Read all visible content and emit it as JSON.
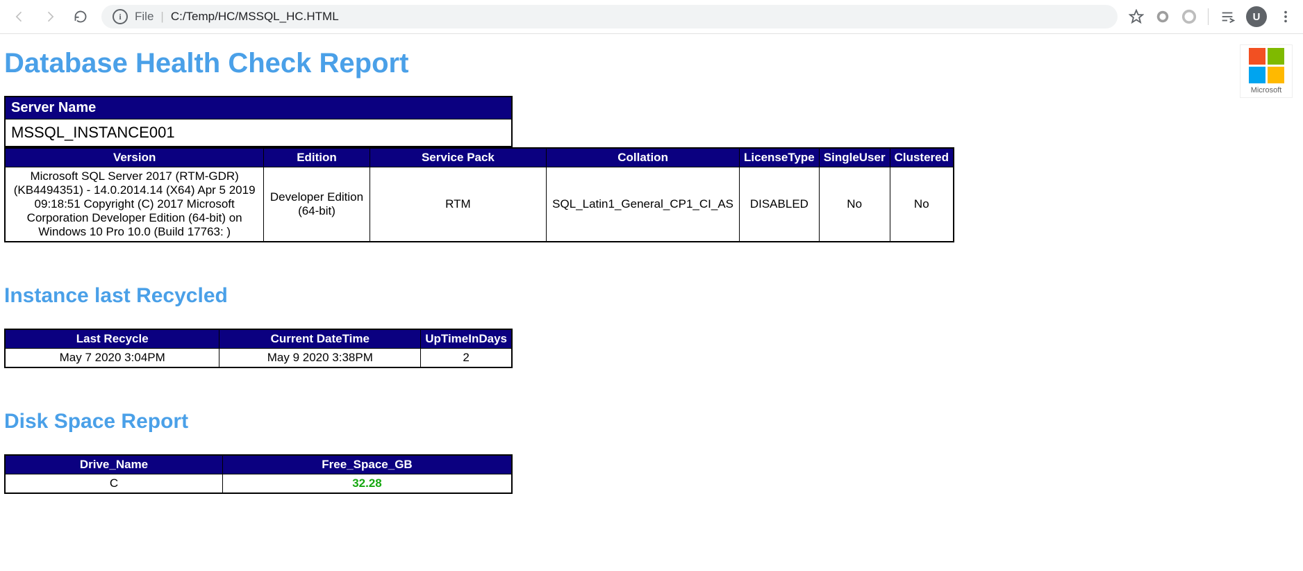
{
  "browser": {
    "url_prefix": "File",
    "url_path": "C:/Temp/HC/MSSQL_HC.HTML",
    "avatar_letter": "U"
  },
  "logo": {
    "caption": "Microsoft"
  },
  "title": "Database Health Check Report",
  "server_name_table": {
    "header": "Server Name",
    "value": "MSSQL_INSTANCE001"
  },
  "server_info_table": {
    "headers": [
      "Version",
      "Edition",
      "Service Pack",
      "Collation",
      "LicenseType",
      "SingleUser",
      "Clustered"
    ],
    "row": {
      "version": "Microsoft SQL Server 2017 (RTM-GDR) (KB4494351) - 14.0.2014.14 (X64) Apr 5 2019 09:18:51 Copyright (C) 2017 Microsoft Corporation Developer Edition (64-bit) on Windows 10 Pro 10.0 (Build 17763: )",
      "edition": "Developer Edition (64-bit)",
      "service_pack": "RTM",
      "collation": "SQL_Latin1_General_CP1_CI_AS",
      "license_type": "DISABLED",
      "single_user": "No",
      "clustered": "No"
    }
  },
  "recycle_section": {
    "title": "Instance last Recycled",
    "headers": [
      "Last Recycle",
      "Current DateTime",
      "UpTimeInDays"
    ],
    "row": {
      "last_recycle": "May 7 2020 3:04PM",
      "current_datetime": "May 9 2020 3:38PM",
      "uptime_days": "2"
    }
  },
  "disk_section": {
    "title": "Disk Space Report",
    "headers": [
      "Drive_Name",
      "Free_Space_GB"
    ],
    "row": {
      "drive": "C",
      "free_gb": "32.28"
    }
  }
}
